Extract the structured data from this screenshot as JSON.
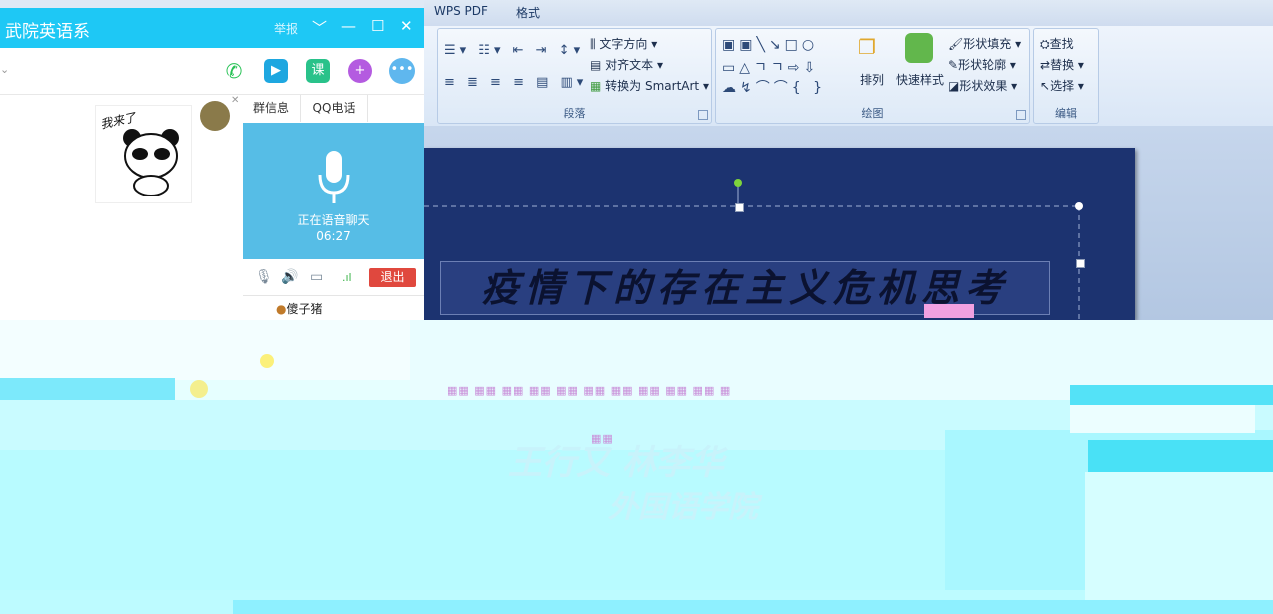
{
  "ribbon": {
    "tabs": [
      "WPS PDF",
      "格式"
    ],
    "paragraph": {
      "text_direction": "文字方向",
      "align_text": "对齐文本",
      "convert_smartart": "转换为 SmartArt",
      "label": "段落"
    },
    "drawing": {
      "arrange": "排列",
      "quick_styles": "快速样式",
      "shape_fill": "形状填充",
      "shape_outline": "形状轮廓",
      "shape_effects": "形状效果",
      "label": "绘图"
    },
    "editing": {
      "find": "查找",
      "replace": "替换",
      "select": "选择",
      "label": "编辑"
    }
  },
  "slide": {
    "title": "疫情下的存在主义危机思考"
  },
  "qq": {
    "window_title": "武院英语系",
    "report_label": "举报",
    "panel_tabs": [
      "群信息",
      "QQ电话"
    ],
    "voice_status": "正在语音聊天",
    "voice_time": "06:27",
    "exit_label": "退出",
    "member_name": "傻子猪",
    "sticker_text": "我来了"
  },
  "ghost_text": {
    "line1": "王行又 林李华",
    "line2": "外国语学院"
  },
  "colors": {
    "qq_titlebar": "#1ec8f5",
    "voice_panel": "#56bde6",
    "exit_button": "#e0483e",
    "slide_background": "#1c3370",
    "glitch_cyan": "#8ef0ff"
  }
}
